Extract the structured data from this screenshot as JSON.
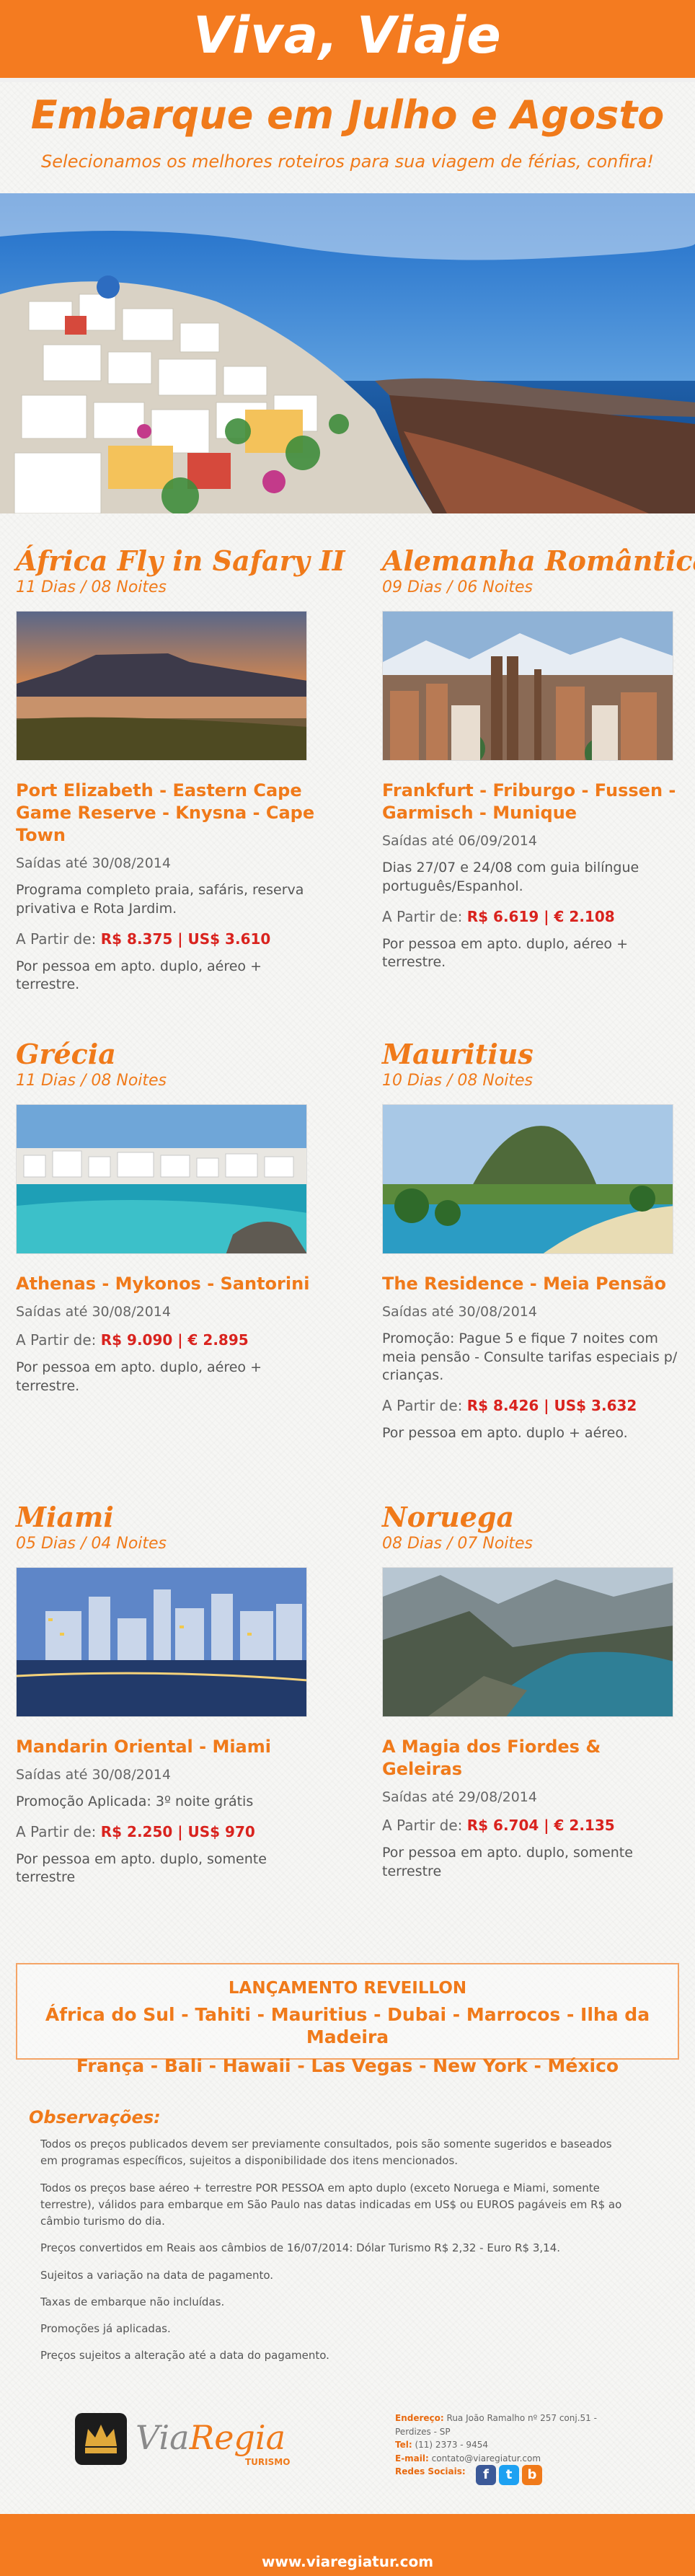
{
  "header": {
    "brand_title": "Viva, Viaje",
    "headline": "Embarque em Julho e Agosto",
    "subheadline": "Selecionamos os melhores roteiros para sua viagem de férias, confira!"
  },
  "hero": {
    "image": "santorini-coast-photo"
  },
  "destinations": [
    {
      "name": "África Fly in Safary II",
      "duration": "11 Dias / 08 Noites",
      "image": "table-mountain-sunset-photo",
      "route": "Port  Elizabeth - Eastern Cape Game Reserve - Knysna - Cape Town",
      "departs": "Saídas até 30/08/2014",
      "desc": "Programa completo praia, safáris, reserva privativa e Rota Jardim.",
      "price_label": "A Partir de:",
      "price_value": "R$ 8.375 | US$ 3.610",
      "note": "Por pessoa em apto. duplo, aéreo + terrestre."
    },
    {
      "name": "Alemanha Romântica",
      "duration": "09 Dias / 06 Noites",
      "image": "munich-skyline-photo",
      "route": "Frankfurt - Friburgo - Fussen - Garmisch - Munique",
      "departs": "Saídas até 06/09/2014",
      "desc": "Dias 27/07 e 24/08 com guia bilíngue português/Espanhol.",
      "price_label": "A Partir de:",
      "price_value": "R$ 6.619 | € 2.108",
      "note": "Por pessoa em apto. duplo, aéreo + terrestre."
    },
    {
      "name": "Grécia",
      "duration": "11 Dias / 08 Noites",
      "image": "greek-island-harbour-photo",
      "route": "Athenas - Mykonos - Santorini",
      "departs": "Saídas até 30/08/2014",
      "desc": "",
      "price_label": "A Partir de:",
      "price_value": "R$ 9.090 | € 2.895",
      "note": "Por pessoa em apto. duplo, aéreo + terrestre."
    },
    {
      "name": "Mauritius",
      "duration": "10 Dias / 08 Noites",
      "image": "mauritius-mountain-beach-photo",
      "route": "The Residence - Meia Pensão",
      "departs": "Saídas até 30/08/2014",
      "desc": "Promoção: Pague 5 e fique 7 noites com meia pensão - Consulte tarifas especiais p/ crianças.",
      "price_label": "A Partir de:",
      "price_value": "R$ 8.426 | US$ 3.632",
      "note": "Por pessoa em apto. duplo + aéreo."
    },
    {
      "name": "Miami",
      "duration": "05 Dias / 04 Noites",
      "image": "miami-night-skyline-photo",
      "route": "Mandarin Oriental - Miami",
      "departs": "Saídas até 30/08/2014",
      "desc": "Promoção Aplicada: 3º noite grátis",
      "price_label": "A Partir de:",
      "price_value": "R$ 2.250 | US$ 970",
      "note": "Por pessoa em apto. duplo, somente terrestre"
    },
    {
      "name": "Noruega",
      "duration": "08 Dias / 07 Noites",
      "image": "norway-fjord-photo",
      "route": "A Magia dos Fiordes & Geleiras",
      "departs": "Saídas até 29/08/2014",
      "desc": "",
      "price_label": "A Partir de:",
      "price_value": "R$ 6.704 | € 2.135",
      "note": "Por pessoa em apto. duplo, somente terrestre"
    }
  ],
  "reveillon": {
    "title": "LANÇAMENTO REVEILLON",
    "line1": "África do Sul - Tahiti - Mauritius - Dubai - Marrocos - Ilha da Madeira",
    "line2": "França - Bali - Hawaii - Las Vegas - New York - México"
  },
  "observations": {
    "title": "Observações:",
    "items": [
      "Todos os preços publicados devem ser previamente consultados, pois são somente sugeridos e baseados em programas específicos, sujeitos a disponibilidade dos itens mencionados.",
      "Todos os preços base aéreo + terrestre POR PESSOA em apto duplo (exceto Noruega e Miami, somente terrestre), válidos para embarque em São Paulo nas datas indicadas em US$ ou EUROS pagáveis em R$ ao câmbio turismo do dia.",
      "Preços convertidos em Reais aos câmbios de 16/07/2014: Dólar Turismo R$ 2,32 - Euro R$ 3,14.",
      "Sujeitos a variação na data de pagamento.",
      "Taxas de embarque não incluídas.",
      "Promoções já aplicadas.",
      "Preços sujeitos a alteração até a data do pagamento."
    ]
  },
  "footer": {
    "logo_text": "ViaRegia",
    "logo_sub": "TURISMO",
    "address_label": "Endereço:",
    "address": "Rua João Ramalho nº 257 conj.51 - Perdizes - SP",
    "phone_label": "Tel:",
    "phone": "(11) 2373 - 9454",
    "email_label": "E-mail:",
    "email": "contato@viaregiatur.com",
    "social_label": "Redes Sociais:",
    "site_url": "www.viaregiatur.com"
  },
  "colors": {
    "brand_orange": "#f47b20",
    "price_red": "#d9231e"
  }
}
